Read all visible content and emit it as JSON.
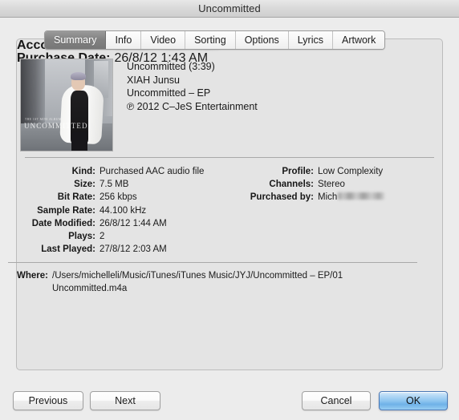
{
  "window": {
    "title": "Uncommitted"
  },
  "tabs": [
    {
      "label": "Summary",
      "selected": true
    },
    {
      "label": "Info",
      "selected": false
    },
    {
      "label": "Video",
      "selected": false
    },
    {
      "label": "Sorting",
      "selected": false
    },
    {
      "label": "Options",
      "selected": false
    },
    {
      "label": "Lyrics",
      "selected": false
    },
    {
      "label": "Artwork",
      "selected": false
    }
  ],
  "track": {
    "title_with_duration": "Uncommitted (3:39)",
    "artist": "XIAH Junsu",
    "album": "Uncommitted – EP",
    "copyright": "℗ 2012 C–JeS Entertainment",
    "artwork": {
      "cover_title": "UNCOMMITTED",
      "cover_kicker": "THE 1ST MINI ALBUM"
    }
  },
  "details_left": [
    {
      "label": "Kind:",
      "value": "Purchased AAC audio file"
    },
    {
      "label": "Size:",
      "value": "7.5 MB"
    },
    {
      "label": "Bit Rate:",
      "value": "256 kbps"
    },
    {
      "label": "Sample Rate:",
      "value": "44.100 kHz"
    },
    {
      "label": "Date Modified:",
      "value": "26/8/12 1:44 AM"
    },
    {
      "label": "Plays:",
      "value": "2"
    },
    {
      "label": "Last Played:",
      "value": "27/8/12 2:03 AM"
    }
  ],
  "details_right": [
    {
      "label": "Profile:",
      "value": "Low Complexity"
    },
    {
      "label": "Channels:",
      "value": "Stereo"
    },
    {
      "label": "Purchased by:",
      "value": "Mich",
      "redacted": true
    },
    {
      "label": "Account Name:",
      "value": "",
      "redacted": true
    },
    {
      "label": "Purchase Date:",
      "value": "26/8/12 1:43 AM"
    }
  ],
  "where": {
    "label": "Where:",
    "path_line1": "/Users/michelleli/Music/iTunes/iTunes Music/JYJ/Uncommitted – EP/01",
    "path_line2": "Uncommitted.m4a"
  },
  "buttons": {
    "previous": "Previous",
    "next": "Next",
    "cancel": "Cancel",
    "ok": "OK"
  },
  "colors": {
    "default_button_blue": "#8cc4ef",
    "selected_tab_gray": "#818181",
    "panel_background": "#e4e4e4",
    "window_background": "#ececec"
  }
}
